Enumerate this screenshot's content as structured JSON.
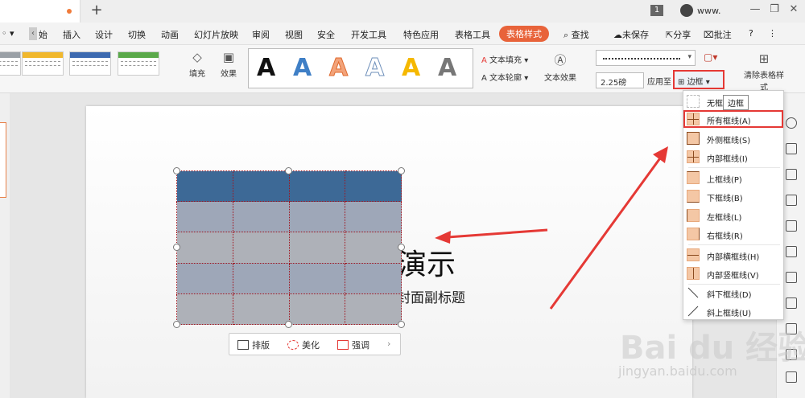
{
  "titlebar": {
    "window_count_badge": "1",
    "user_name": "www.",
    "win_minimize": "—",
    "win_restore": "❐",
    "win_close": "✕",
    "new_tab": "+"
  },
  "menu": {
    "items": [
      "始",
      "插入",
      "设计",
      "切换",
      "动画",
      "幻灯片放映",
      "审阅",
      "视图",
      "安全",
      "开发工具",
      "特色应用",
      "表格工具",
      "表格样式"
    ],
    "search": "查找",
    "unsaved": "未保存",
    "share": "分享",
    "annotate": "批注",
    "help": "?",
    "more": "⋮",
    "left_glyph": "◦ ▾"
  },
  "ribbon": {
    "fill": "填充",
    "effect": "效果",
    "art_letters": [
      "A",
      "A",
      "A",
      "A",
      "A",
      "A"
    ],
    "text_fill": "文本填充",
    "text_outline": "文本轮廓",
    "text_effect": "文本效果",
    "line_weight": "2.25磅",
    "apply_to": "应用至",
    "border": "边框",
    "clear_style": "清除表格样式"
  },
  "slide": {
    "title": "演示",
    "subtitle": "封面副标题"
  },
  "floatbar": {
    "layout": "排版",
    "beautify": "美化",
    "emphasize": "强调",
    "more": "›"
  },
  "dropdown": {
    "tooltip": "边框",
    "items": [
      {
        "label": "无框线"
      },
      {
        "label": "所有框线(A)"
      },
      {
        "label": "外侧框线(S)"
      },
      {
        "label": "内部框线(I)"
      },
      {
        "label": "上框线(P)"
      },
      {
        "label": "下框线(B)"
      },
      {
        "label": "左框线(L)"
      },
      {
        "label": "右框线(R)"
      },
      {
        "label": "内部横框线(H)"
      },
      {
        "label": "内部竖框线(V)"
      },
      {
        "label": "斜下框线(D)"
      },
      {
        "label": "斜上框线(U)"
      }
    ]
  },
  "watermark": {
    "brand": "Bai du 经验",
    "url": "jingyan.baidu.com"
  },
  "colors": {
    "accent": "#e8633a",
    "highlight": "#e53935",
    "table_header": "#3d6996",
    "table_body": "#9ea7b8"
  }
}
